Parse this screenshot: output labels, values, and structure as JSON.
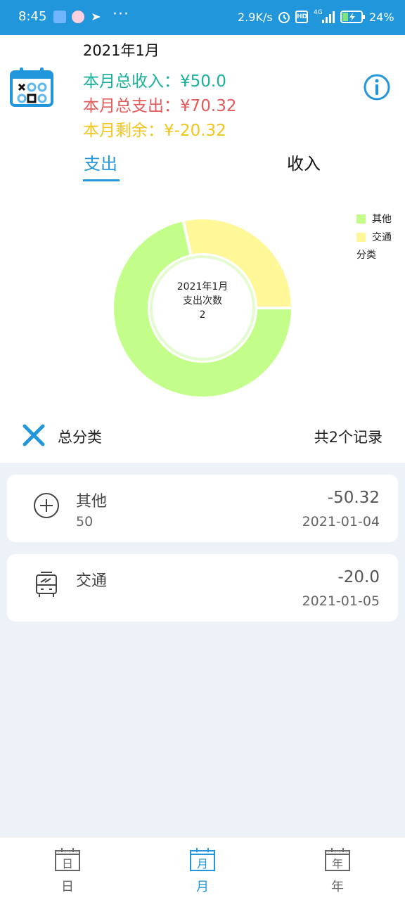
{
  "status_bar": {
    "time": "8:45",
    "dots": "···",
    "net_speed": "2.9K/s",
    "hd": "HD",
    "network": "4G",
    "battery": "24%"
  },
  "header": {
    "month_title": "2021年1月",
    "total_income": "本月总收入：¥50.0",
    "total_expense": "本月总支出：¥70.32",
    "remaining": "本月剩余：¥-20.32"
  },
  "tabs": {
    "expense": "支出",
    "income": "收入"
  },
  "chart_data": {
    "type": "pie",
    "categories": [
      "其他",
      "交通"
    ],
    "values": [
      50.32,
      20.0
    ],
    "colors": [
      "#c3fe8a",
      "#fff798"
    ],
    "center_text": [
      "2021年1月",
      "支出次数",
      "2"
    ],
    "legend_title": "分类",
    "legend_position": "top-right"
  },
  "category_bar": {
    "label": "总分类",
    "record_count": "共2个记录"
  },
  "records": [
    {
      "name": "其他",
      "note": "50",
      "amount": "-50.32",
      "date": "2021-01-04",
      "icon": "plus-circle-icon"
    },
    {
      "name": "交通",
      "note": "",
      "amount": "-20.0",
      "date": "2021-01-05",
      "icon": "bus-icon"
    }
  ],
  "bottom_nav": [
    {
      "icon_text": "日",
      "label": "日",
      "active": false
    },
    {
      "icon_text": "月",
      "label": "月",
      "active": true
    },
    {
      "icon_text": "年",
      "label": "年",
      "active": false
    }
  ],
  "colors": {
    "primary": "#2196db",
    "income": "#19b199",
    "expense": "#e35a5a",
    "remain": "#f2c51a",
    "list_bg": "#ecf2f8",
    "nav_inactive": "#666666"
  }
}
